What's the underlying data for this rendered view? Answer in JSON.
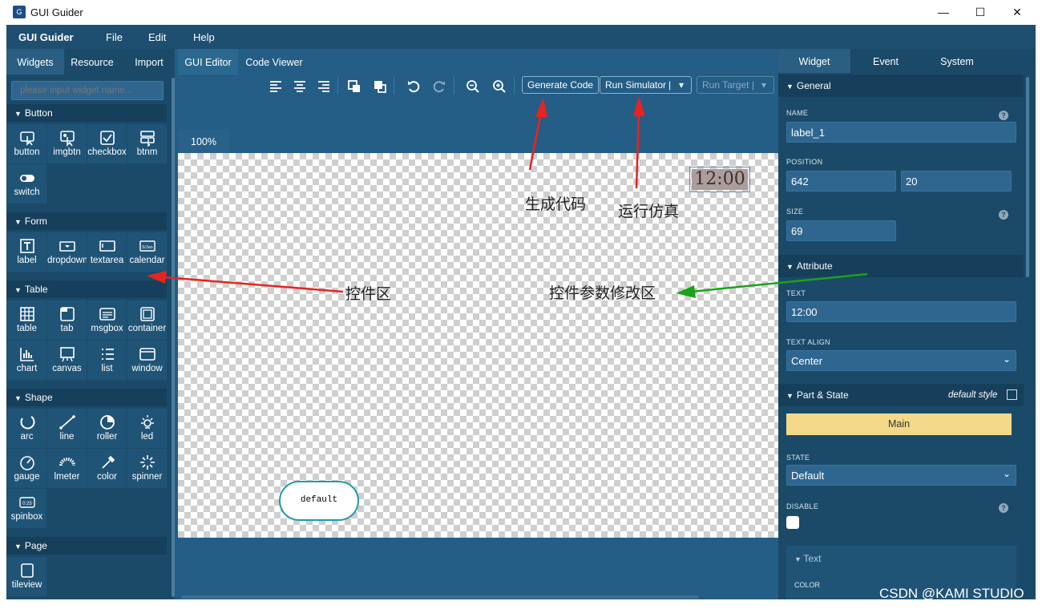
{
  "window": {
    "title": "GUI Guider",
    "minimize_glyph": "—",
    "maximize_glyph": "☐",
    "close_glyph": "✕"
  },
  "menubar": {
    "app_name": "GUI Guider",
    "items": [
      "File",
      "Edit",
      "Help"
    ]
  },
  "left_panel": {
    "tabs": [
      "Widgets",
      "Resource",
      "Import"
    ],
    "search_placeholder": "please input widget name...",
    "categories": [
      {
        "label": "Button",
        "items": [
          {
            "label": "button",
            "icon": "button-icon"
          },
          {
            "label": "imgbtn",
            "icon": "imgbtn-icon"
          },
          {
            "label": "checkbox",
            "icon": "checkbox-icon"
          },
          {
            "label": "btnm",
            "icon": "btnm-icon"
          },
          {
            "label": "switch",
            "icon": "switch-icon"
          }
        ]
      },
      {
        "label": "Form",
        "items": [
          {
            "label": "label",
            "icon": "label-icon"
          },
          {
            "label": "dropdown",
            "icon": "dropdown-icon"
          },
          {
            "label": "textarea",
            "icon": "textarea-icon"
          },
          {
            "label": "calendar",
            "icon": "calendar-icon"
          }
        ]
      },
      {
        "label": "Table",
        "items": [
          {
            "label": "table",
            "icon": "table-icon"
          },
          {
            "label": "tab",
            "icon": "tab-icon"
          },
          {
            "label": "msgbox",
            "icon": "msgbox-icon"
          },
          {
            "label": "container",
            "icon": "container-icon"
          },
          {
            "label": "chart",
            "icon": "chart-icon"
          },
          {
            "label": "canvas",
            "icon": "canvas-icon"
          },
          {
            "label": "list",
            "icon": "list-icon"
          },
          {
            "label": "window",
            "icon": "window-icon"
          }
        ]
      },
      {
        "label": "Shape",
        "items": [
          {
            "label": "arc",
            "icon": "arc-icon"
          },
          {
            "label": "line",
            "icon": "line-icon"
          },
          {
            "label": "roller",
            "icon": "roller-icon"
          },
          {
            "label": "led",
            "icon": "led-icon"
          },
          {
            "label": "gauge",
            "icon": "gauge-icon"
          },
          {
            "label": "lmeter",
            "icon": "lmeter-icon"
          },
          {
            "label": "color",
            "icon": "color-icon"
          },
          {
            "label": "spinner",
            "icon": "spinner-icon"
          },
          {
            "label": "spinbox",
            "icon": "spinbox-icon"
          }
        ]
      },
      {
        "label": "Page",
        "items": [
          {
            "label": "tileview",
            "icon": "tileview-icon"
          }
        ]
      }
    ],
    "calendar_icon_text": "5/Jan",
    "spinbox_icon_text": "0:25"
  },
  "center": {
    "tabs": [
      "GUI Editor",
      "Code Viewer"
    ],
    "toolbar": {
      "generate_code": "Generate Code",
      "run_simulator": "Run Simulator",
      "run_target": "Run Target",
      "dropdown_glyph": "▾",
      "sep": "|"
    },
    "zoom": "100%",
    "canvas": {
      "clock_text": "12:00",
      "default_button_text": "default"
    }
  },
  "annotations": {
    "generate_code": "生成代码",
    "run_sim": "运行仿真",
    "widget_area": "控件区",
    "param_area": "控件参数修改区"
  },
  "right_panel": {
    "tabs": [
      "Widget",
      "Event",
      "System"
    ],
    "general": {
      "title": "General",
      "name_label": "NAME",
      "name_value": "label_1",
      "position_label": "POSITION",
      "pos_x": "642",
      "pos_y": "20",
      "size_label": "SIZE",
      "size_value": "69",
      "help": "?"
    },
    "attribute": {
      "title": "Attribute",
      "text_label": "TEXT",
      "text_value": "12:00",
      "align_label": "TEXT ALIGN",
      "align_value": "Center"
    },
    "part_state": {
      "title": "Part & State",
      "default_style": "default style",
      "main": "Main",
      "state_label": "STATE",
      "state_value": "Default",
      "disable_label": "DISABLE"
    },
    "text_section": {
      "title": "Text",
      "color_label": "COLOR"
    }
  },
  "watermark": "CSDN @KAMI STUDIO",
  "colors": {
    "arrow_red": "#e8231f",
    "arrow_green": "#1aa31a",
    "main_bar": "#f5d98a",
    "accent": "#2b6890"
  }
}
